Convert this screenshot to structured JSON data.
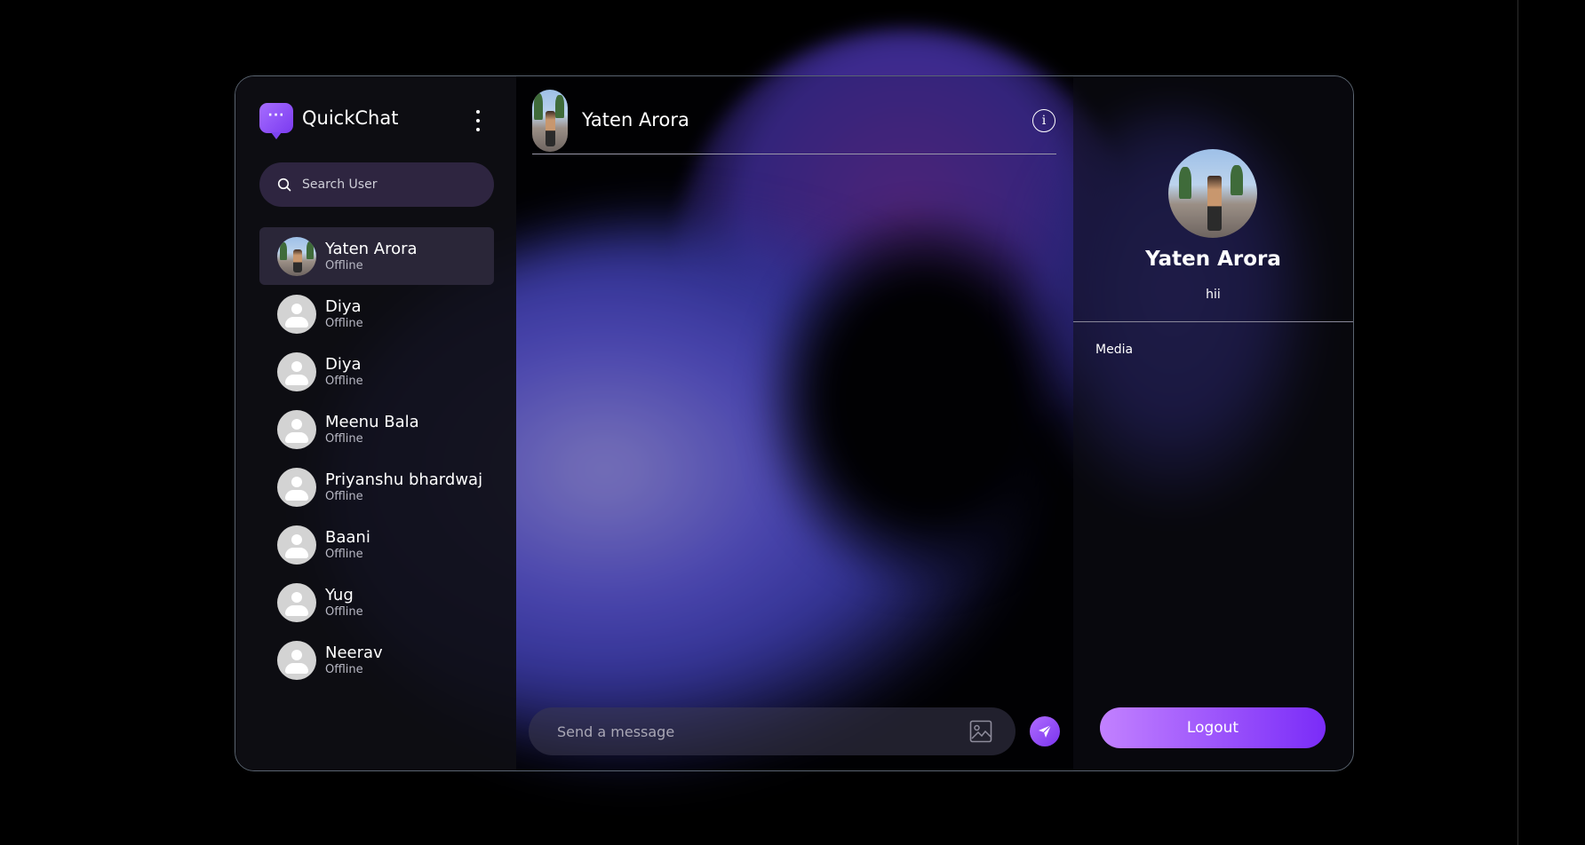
{
  "app": {
    "name": "QuickChat"
  },
  "search": {
    "placeholder": "Search User"
  },
  "users": [
    {
      "name": "Yaten Arora",
      "status": "Offline",
      "avatar": "photo",
      "active": true
    },
    {
      "name": "Diya",
      "status": "Offline",
      "avatar": "default"
    },
    {
      "name": "Diya",
      "status": "Offline",
      "avatar": "default"
    },
    {
      "name": "Meenu Bala",
      "status": "Offline",
      "avatar": "default"
    },
    {
      "name": "Priyanshu bhardwaj",
      "status": "Offline",
      "avatar": "default"
    },
    {
      "name": "Baani",
      "status": "Offline",
      "avatar": "default"
    },
    {
      "name": "Yug",
      "status": "Offline",
      "avatar": "default"
    },
    {
      "name": "Neerav",
      "status": "Offline",
      "avatar": "default"
    }
  ],
  "chat": {
    "contact_name": "Yaten Arora",
    "composer_placeholder": "Send a message"
  },
  "profile": {
    "name": "Yaten Arora",
    "bio": "hii",
    "media_label": "Media",
    "logout_label": "Logout"
  },
  "icons": {
    "menu": "kebab-menu-icon",
    "search": "search-icon",
    "info": "info-icon",
    "image": "image-upload-icon",
    "send": "send-icon"
  },
  "colors": {
    "accent": "#8b45f6",
    "search_bg": "#2e2540",
    "active_row": "#2a2638"
  }
}
